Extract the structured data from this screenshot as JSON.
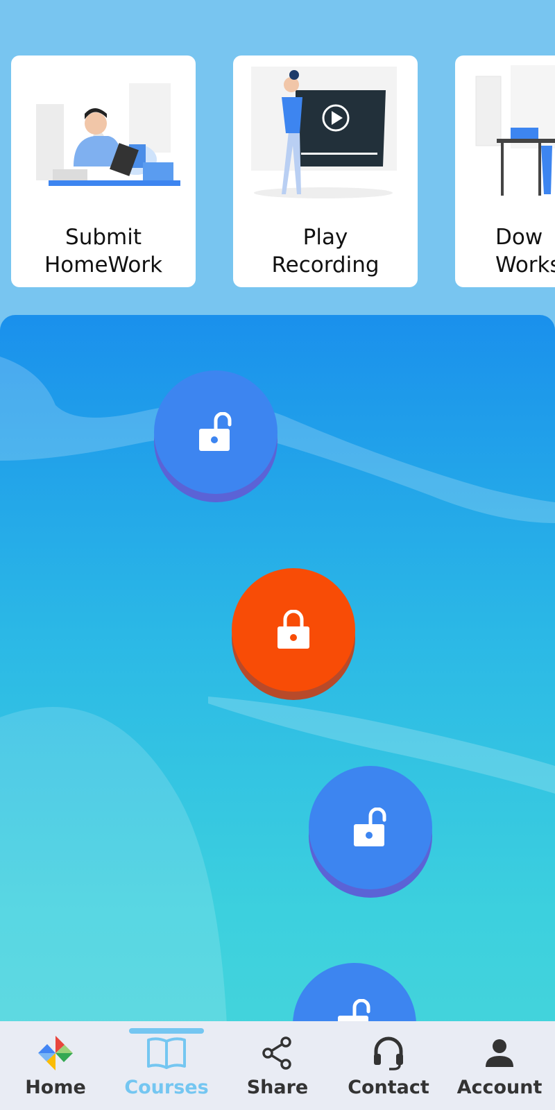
{
  "cards": [
    {
      "title": "Submit\nHomeWork",
      "line1": "Submit",
      "line2": "HomeWork",
      "icon": "student-writing-illustration"
    },
    {
      "title": "Play\nRecording",
      "line1": "Play",
      "line2": "Recording",
      "icon": "video-player-illustration"
    },
    {
      "title": "Download\nWorksheet",
      "line1": "Dow",
      "line2": "Works",
      "icon": "desk-illustration"
    }
  ],
  "levels": [
    {
      "state": "unlocked",
      "icon": "unlock-icon",
      "color": "#3d85f0"
    },
    {
      "state": "locked",
      "icon": "lock-icon",
      "color": "#f84c06"
    },
    {
      "state": "unlocked",
      "icon": "unlock-icon",
      "color": "#3d85f0"
    },
    {
      "state": "unlocked",
      "icon": "unlock-icon",
      "color": "#3d85f0"
    }
  ],
  "nav": {
    "items": [
      {
        "label": "Home",
        "icon": "pinwheel-icon"
      },
      {
        "label": "Courses",
        "icon": "book-icon",
        "active": true
      },
      {
        "label": "Share",
        "icon": "share-icon"
      },
      {
        "label": "Contact",
        "icon": "headset-icon"
      },
      {
        "label": "Account",
        "icon": "person-icon"
      }
    ]
  },
  "colors": {
    "background": "#78c5f0",
    "accent": "#74c6f1",
    "unlocked": "#3d85f0",
    "locked": "#f84c06"
  }
}
